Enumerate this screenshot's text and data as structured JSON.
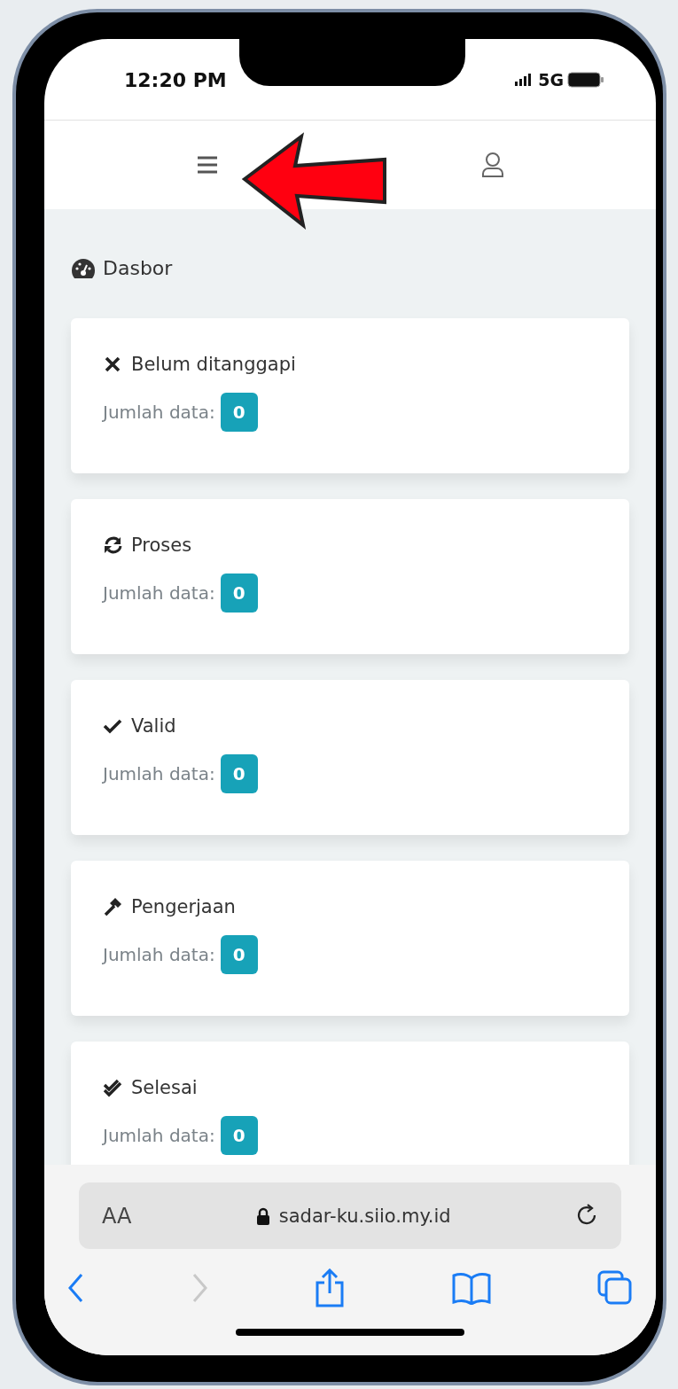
{
  "status_bar": {
    "time": "12:20 PM",
    "network": "5G"
  },
  "page_title": "Dasbor",
  "cards": [
    {
      "kind": "unanswered",
      "title": "Belum ditanggapi",
      "label": "Jumlah data:",
      "count": "0"
    },
    {
      "kind": "process",
      "title": "Proses",
      "label": "Jumlah data:",
      "count": "0"
    },
    {
      "kind": "valid",
      "title": "Valid",
      "label": "Jumlah data:",
      "count": "0"
    },
    {
      "kind": "work",
      "title": "Pengerjaan",
      "label": "Jumlah data:",
      "count": "0"
    },
    {
      "kind": "done",
      "title": "Selesai",
      "label": "Jumlah data:",
      "count": "0"
    }
  ],
  "browser": {
    "text_size_button": "AA",
    "url": "sadar-ku.siio.my.id",
    "forward_disabled": true
  }
}
